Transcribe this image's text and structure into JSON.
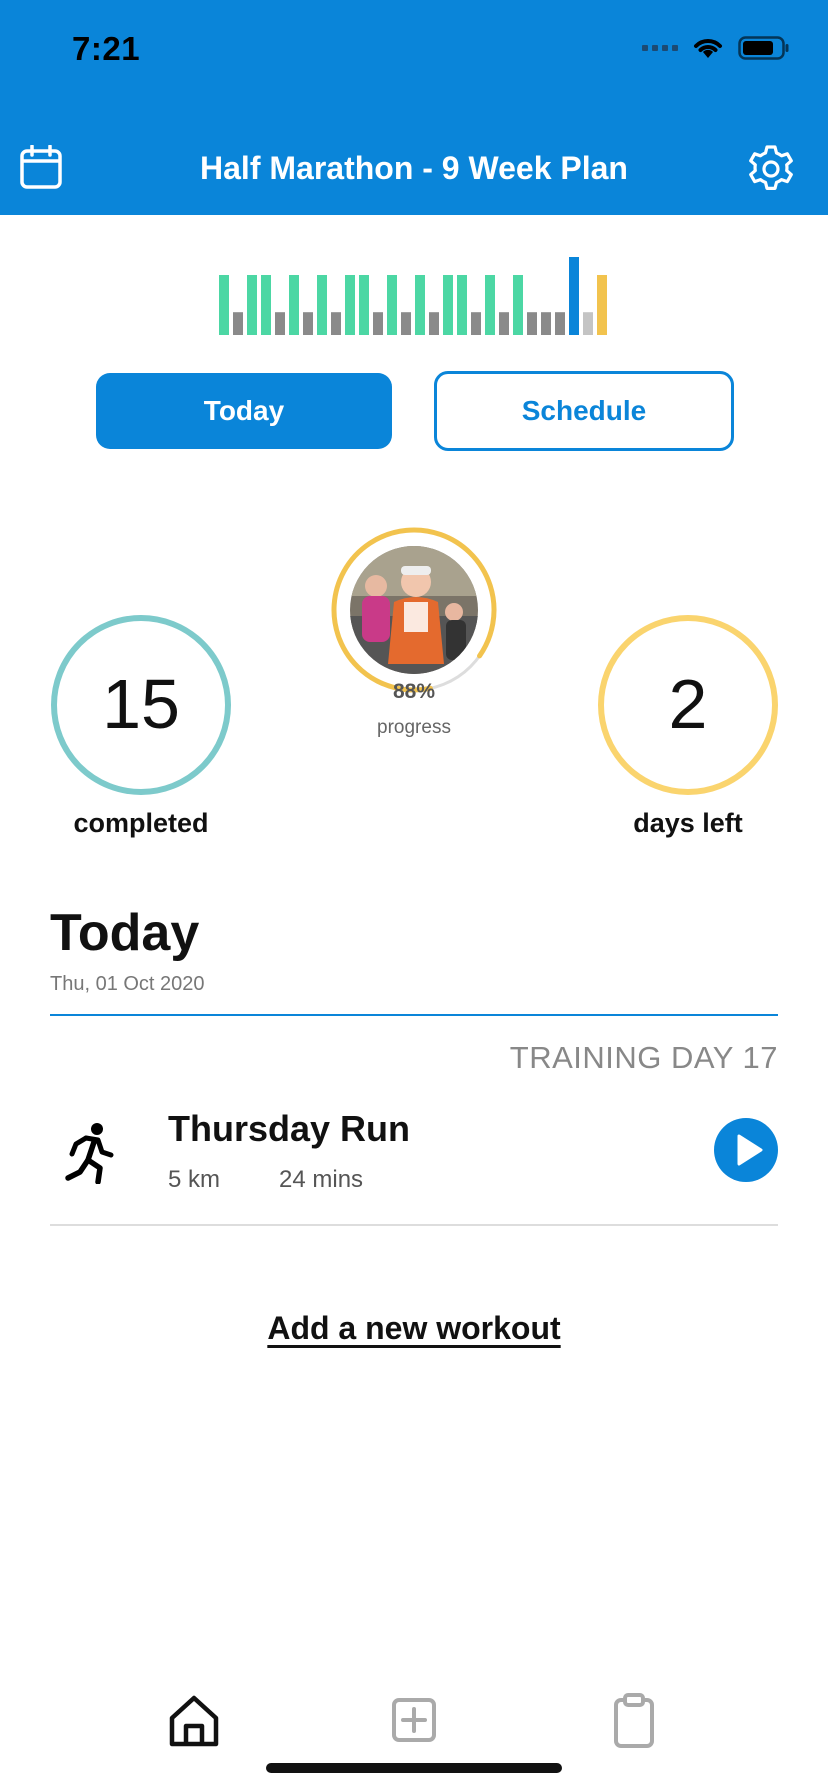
{
  "status_bar": {
    "time": "7:21"
  },
  "nav": {
    "title": "Half Marathon - 9 Week Plan",
    "left_icon": "calendar-icon",
    "right_icon": "gear-icon"
  },
  "colors": {
    "primary": "#0A85D9",
    "teal": "#7DCACB",
    "yellow": "#FAD46E",
    "green_bar": "#4CD7A4",
    "gray_bar": "#8A8A8A",
    "light_gray_bar": "#C4C4C4",
    "yellow_bar": "#F2C34E"
  },
  "week_bars": [
    {
      "level": 1.0,
      "status": "done"
    },
    {
      "level": 0.38,
      "status": "rest"
    },
    {
      "level": 1.0,
      "status": "done"
    },
    {
      "level": 1.0,
      "status": "done"
    },
    {
      "level": 0.38,
      "status": "rest"
    },
    {
      "level": 1.0,
      "status": "done"
    },
    {
      "level": 0.38,
      "status": "rest"
    },
    {
      "level": 1.0,
      "status": "done"
    },
    {
      "level": 0.38,
      "status": "rest"
    },
    {
      "level": 1.0,
      "status": "done"
    },
    {
      "level": 1.0,
      "status": "done"
    },
    {
      "level": 0.38,
      "status": "rest"
    },
    {
      "level": 1.0,
      "status": "done"
    },
    {
      "level": 0.38,
      "status": "rest"
    },
    {
      "level": 1.0,
      "status": "done"
    },
    {
      "level": 0.38,
      "status": "rest"
    },
    {
      "level": 1.0,
      "status": "done"
    },
    {
      "level": 1.0,
      "status": "done"
    },
    {
      "level": 0.38,
      "status": "rest"
    },
    {
      "level": 1.0,
      "status": "done"
    },
    {
      "level": 0.38,
      "status": "rest"
    },
    {
      "level": 1.0,
      "status": "done"
    },
    {
      "level": 0.38,
      "status": "rest"
    },
    {
      "level": 0.38,
      "status": "rest"
    },
    {
      "level": 0.38,
      "status": "rest"
    },
    {
      "level": 1.3,
      "status": "today"
    },
    {
      "level": 0.38,
      "status": "future-rest"
    },
    {
      "level": 1.0,
      "status": "future"
    }
  ],
  "segment": {
    "today_label": "Today",
    "schedule_label": "Schedule"
  },
  "stats": {
    "completed_value": "15",
    "completed_label": "completed",
    "progress_pct": "88%",
    "progress_fraction": 0.88,
    "progress_label": "progress",
    "days_left_value": "2",
    "days_left_label": "days left"
  },
  "today": {
    "title": "Today",
    "date": "Thu, 01 Oct 2020",
    "training_day": "TRAINING DAY 17"
  },
  "workout": {
    "icon": "running-icon",
    "name": "Thursday Run",
    "distance": "5 km",
    "duration": "24 mins"
  },
  "add_workout_label": "Add a new workout",
  "tabbar": {
    "items": [
      "home-icon",
      "add-icon",
      "clipboard-icon"
    ]
  }
}
